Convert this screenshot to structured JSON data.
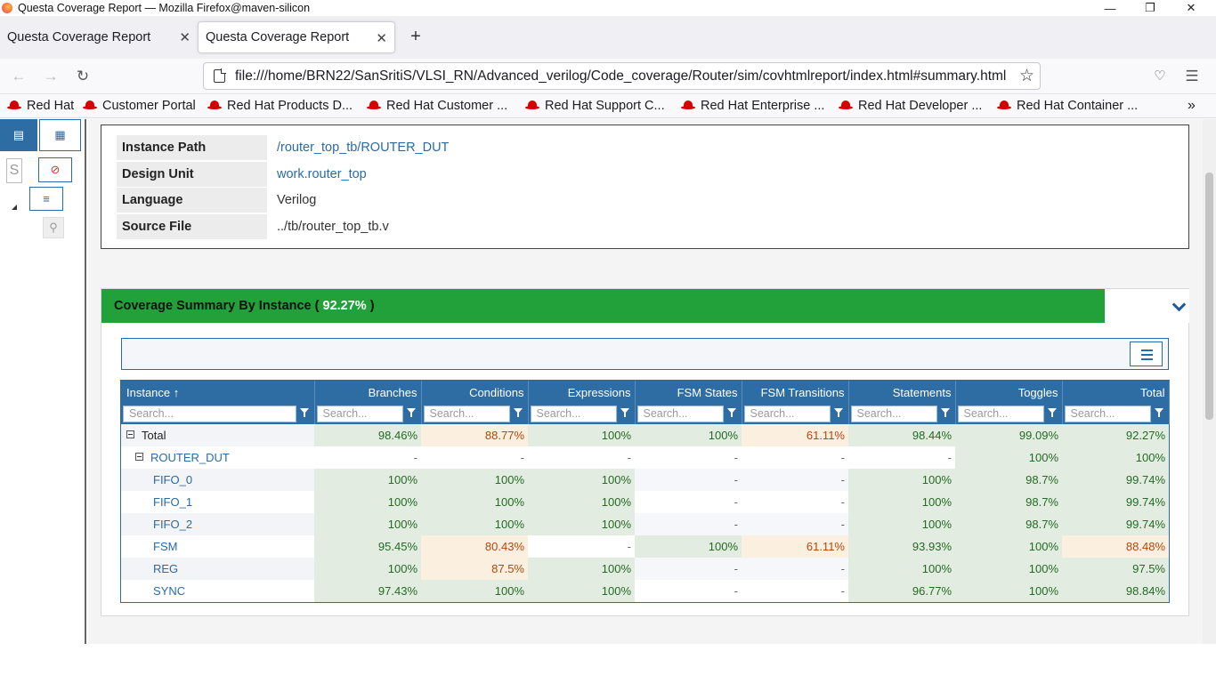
{
  "window": {
    "title": "Questa Coverage Report — Mozilla Firefox@maven-silicon"
  },
  "tabs": [
    {
      "label": "Questa Coverage Report"
    },
    {
      "label": "Questa Coverage Report"
    }
  ],
  "nav": {
    "url": "file:///home/BRN22/SanSritiS/VLSI_RN/Advanced_verilog/Code_coverage/Router/sim/covhtmlreport/index.html#summary.html"
  },
  "bookmarks": [
    {
      "label": "Red Hat"
    },
    {
      "label": "Customer Portal"
    },
    {
      "label": "Red Hat Products D..."
    },
    {
      "label": "Red Hat Customer ..."
    },
    {
      "label": "Red Hat Support C..."
    },
    {
      "label": "Red Hat Enterprise ..."
    },
    {
      "label": "Red Hat Developer ..."
    },
    {
      "label": "Red Hat Container ..."
    }
  ],
  "sidebar": {
    "search_letter": "S"
  },
  "info": {
    "rows": [
      {
        "label": "Instance Path",
        "value": "/router_top_tb/ROUTER_DUT"
      },
      {
        "label": "Design Unit",
        "value": "work.router_top"
      },
      {
        "label": "Language",
        "value": "Verilog"
      },
      {
        "label": "Source File",
        "value": "../tb/router_top_tb.v"
      }
    ]
  },
  "coverage": {
    "title": "Coverage Summary By Instance (",
    "percent": "92.27%",
    "title_end": ")",
    "columns": [
      "Instance",
      "Branches",
      "Conditions",
      "Expressions",
      "FSM States",
      "FSM Transitions",
      "Statements",
      "Toggles",
      "Total"
    ],
    "sort_indicator": "↑",
    "search_placeholder": "Search...",
    "rows": [
      {
        "name": "Total",
        "cells": [
          "98.46%",
          "88.77%",
          "100%",
          "100%",
          "61.11%",
          "98.44%",
          "99.09%",
          "92.27%"
        ]
      },
      {
        "name": "ROUTER_DUT",
        "cells": [
          "-",
          "-",
          "-",
          "-",
          "-",
          "-",
          "100%",
          "100%"
        ]
      },
      {
        "name": "FIFO_0",
        "cells": [
          "100%",
          "100%",
          "100%",
          "-",
          "-",
          "100%",
          "98.7%",
          "99.74%"
        ]
      },
      {
        "name": "FIFO_1",
        "cells": [
          "100%",
          "100%",
          "100%",
          "-",
          "-",
          "100%",
          "98.7%",
          "99.74%"
        ]
      },
      {
        "name": "FIFO_2",
        "cells": [
          "100%",
          "100%",
          "100%",
          "-",
          "-",
          "100%",
          "98.7%",
          "99.74%"
        ]
      },
      {
        "name": "FSM",
        "cells": [
          "95.45%",
          "80.43%",
          "-",
          "100%",
          "61.11%",
          "93.93%",
          "100%",
          "88.48%"
        ]
      },
      {
        "name": "REG",
        "cells": [
          "100%",
          "87.5%",
          "100%",
          "-",
          "-",
          "100%",
          "100%",
          "97.5%"
        ]
      },
      {
        "name": "SYNC",
        "cells": [
          "97.43%",
          "100%",
          "100%",
          "-",
          "-",
          "96.77%",
          "100%",
          "98.84%"
        ]
      }
    ]
  },
  "colors": {
    "header_green": "#22a03a",
    "table_header": "#2e6da4",
    "good": "#e2ece0",
    "warn": "#fbefe0",
    "link": "#2a6aa8"
  }
}
